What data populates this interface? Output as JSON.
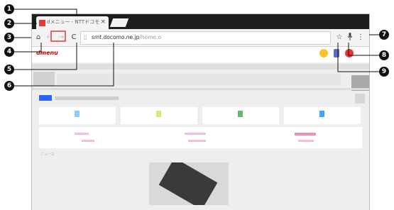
{
  "browser": {
    "tab": {
      "title": "dメニュー - NTTドコモ",
      "close": "×"
    },
    "toolbar": {
      "home": "⌂",
      "back": "←",
      "forward": "→",
      "reload": "C",
      "url_host": "smt.docomo.ne.jp",
      "url_path": "/home.o",
      "bookmark": "☆",
      "mic": "🎙",
      "menu": "⋮"
    }
  },
  "page": {
    "logo": "dmenu",
    "section_label": "ニュース"
  },
  "callouts": [
    "1",
    "2",
    "3",
    "4",
    "5",
    "6",
    "7",
    "8",
    "9"
  ],
  "colors": {
    "tabstrip": "#1e1e1e",
    "accent_red": "#e53935",
    "blue_bar": "#2962ff"
  }
}
